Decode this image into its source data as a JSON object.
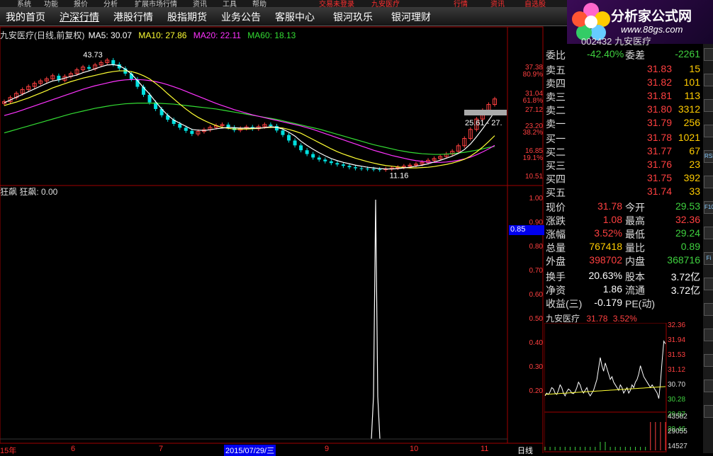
{
  "topbar": {
    "items": [
      "系统",
      "功能",
      "报价",
      "分析",
      "扩展市场行情",
      "资讯",
      "工具",
      "帮助",
      "交易未登录 ",
      "九安医疗",
      "行情",
      "资讯",
      "自选股"
    ]
  },
  "nav": {
    "items": [
      "我的首页",
      "沪深行情",
      "港股行情",
      "股指期货",
      "业务公告",
      "客服中心",
      "银河玖乐",
      "银河理财"
    ]
  },
  "logo": {
    "title": "分析家公式网",
    "url": "www.88gs.com"
  },
  "chart": {
    "title": "九安医疗(日线,前复权)",
    "ma5": "MA5: 30.07",
    "ma10": "MA10: 27.86",
    "ma20": "MA20: 22.11",
    "ma60": "MA60: 18.13",
    "high_label": "43.73",
    "low_label": "11.16",
    "range_label": "25.61 - 27.",
    "yaxis": [
      "37.38",
      "80.9%",
      "31.04",
      "61.8%",
      "27.12",
      "23.20",
      "38.2%",
      "16.85",
      "19.1%",
      "10.51"
    ],
    "indicator_title": "狂飙 狂飙: 0.00",
    "indicator_axis": [
      "1.00",
      "0.90",
      "0.80",
      "0.70",
      "0.60",
      "0.50",
      "0.40",
      "0.30",
      "0.20"
    ],
    "indicator_marker": "0.85",
    "xaxis": [
      "15年",
      "6",
      "7",
      "2015/07/29/三",
      "9",
      "10",
      "11",
      "日线"
    ],
    "series": {
      "closes": [
        31.0,
        32.2,
        33.4,
        34.5,
        35.4,
        36.3,
        37.0,
        37.6,
        38.5,
        37.2,
        38.3,
        39.1,
        40.2,
        41.0,
        40.5,
        41.6,
        42.3,
        43.0,
        41.8,
        40.6,
        39.1,
        37.5,
        35.3,
        33.0,
        30.8,
        28.9,
        27.1,
        25.8,
        24.6,
        23.5,
        22.6,
        21.7,
        22.4,
        22.9,
        23.6,
        24.1,
        24.4,
        23.6,
        22.8,
        23.3,
        23.7,
        23.2,
        23.8,
        24.4,
        24.0,
        22.7,
        21.4,
        19.8,
        18.4,
        17.0,
        15.9,
        14.9,
        14.3,
        13.8,
        13.3,
        12.9,
        12.5,
        12.1,
        11.8,
        11.7,
        11.6,
        11.5,
        11.4,
        11.6,
        11.9,
        12.1,
        12.4,
        12.7,
        13.0,
        13.5,
        14.1,
        14.6,
        15.2,
        15.9,
        16.7,
        18.3,
        20.4,
        23.0,
        26.0,
        28.5,
        30.2,
        31.8
      ],
      "ma5": [
        30.7,
        31.5,
        32.3,
        33.1,
        33.9,
        34.7,
        35.5,
        36.3,
        37.0,
        37.3,
        37.8,
        38.3,
        38.7,
        39.4,
        39.9,
        40.5,
        41.1,
        41.6,
        41.7,
        41.4,
        40.4,
        39.0,
        37.1,
        35.1,
        33.2,
        31.0,
        28.9,
        27.1,
        25.7,
        24.8,
        23.9,
        23.0,
        22.8,
        22.7,
        22.9,
        23.2,
        23.4,
        23.6,
        23.5,
        23.4,
        23.4,
        23.4,
        23.4,
        23.5,
        23.8,
        23.6,
        23.1,
        22.2,
        21.1,
        19.6,
        18.4,
        17.3,
        16.3,
        15.4,
        14.6,
        14.0,
        13.5,
        13.1,
        12.7,
        12.4,
        12.1,
        11.9,
        11.7,
        11.6,
        11.6,
        11.7,
        11.9,
        12.1,
        12.4,
        12.7,
        13.1,
        13.6,
        14.1,
        14.7,
        15.3,
        16.1,
        17.2,
        18.8,
        20.9,
        23.2,
        25.6,
        28.1
      ],
      "ma10": [
        29.9,
        30.4,
        30.9,
        31.5,
        32.1,
        32.8,
        33.5,
        34.2,
        35.0,
        35.6,
        36.2,
        36.8,
        37.3,
        37.8,
        38.2,
        38.6,
        39.0,
        39.4,
        39.7,
        39.9,
        39.9,
        39.7,
        39.2,
        38.5,
        37.6,
        36.3,
        34.9,
        33.3,
        31.8,
        30.3,
        28.9,
        27.6,
        26.5,
        25.6,
        24.8,
        24.1,
        23.6,
        23.3,
        23.1,
        23.1,
        23.1,
        23.2,
        23.3,
        23.5,
        23.6,
        23.6,
        23.4,
        23.0,
        22.5,
        21.9,
        21.0,
        20.1,
        19.2,
        18.3,
        17.4,
        16.6,
        15.9,
        15.3,
        14.7,
        14.2,
        13.7,
        13.3,
        12.9,
        12.6,
        12.4,
        12.2,
        12.0,
        11.9,
        11.9,
        12.0,
        12.1,
        12.3,
        12.6,
        12.9,
        13.3,
        13.8,
        14.4,
        15.3,
        16.5,
        17.9,
        19.5,
        21.2
      ],
      "ma20": [
        27.0,
        27.5,
        28.0,
        28.6,
        29.2,
        29.8,
        30.4,
        31.0,
        31.6,
        32.2,
        32.8,
        33.4,
        34.0,
        34.6,
        35.1,
        35.6,
        36.0,
        36.4,
        36.8,
        37.1,
        37.3,
        37.4,
        37.4,
        37.3,
        37.1,
        36.8,
        36.4,
        35.9,
        35.3,
        34.7,
        34.0,
        33.3,
        32.6,
        31.9,
        31.2,
        30.5,
        29.9,
        29.3,
        28.7,
        28.2,
        27.7,
        27.2,
        26.8,
        26.4,
        26.0,
        25.6,
        25.2,
        24.8,
        24.4,
        24.0,
        23.5,
        23.0,
        22.4,
        21.8,
        21.2,
        20.6,
        20.0,
        19.4,
        18.8,
        18.2,
        17.6,
        17.0,
        16.5,
        16.0,
        15.5,
        15.1,
        14.7,
        14.3,
        14.0,
        13.8,
        13.6,
        13.5,
        13.5,
        13.6,
        13.8,
        14.1,
        14.5,
        15.0,
        15.7,
        16.5,
        17.4,
        18.4
      ],
      "ma60": [
        22.0,
        22.5,
        23.0,
        23.5,
        24.0,
        24.5,
        25.0,
        25.5,
        26.0,
        26.5,
        27.0,
        27.5,
        27.9,
        28.3,
        28.7,
        29.1,
        29.4,
        29.7,
        30.0,
        30.2,
        30.4,
        30.5,
        30.6,
        30.6,
        30.6,
        30.6,
        30.5,
        30.4,
        30.3,
        30.1,
        29.9,
        29.7,
        29.5,
        29.3,
        29.1,
        28.9,
        28.6,
        28.3,
        28.0,
        27.7,
        27.4,
        27.1,
        26.8,
        26.5,
        26.2,
        25.9,
        25.5,
        25.1,
        24.7,
        24.3,
        23.9,
        23.5,
        23.1,
        22.6,
        22.1,
        21.6,
        21.1,
        20.6,
        20.1,
        19.6,
        19.1,
        18.6,
        18.2,
        17.8,
        17.4,
        17.0,
        16.7,
        16.4,
        16.2,
        16.0,
        15.9,
        15.8,
        15.8,
        15.9,
        16.0,
        16.2,
        16.4,
        16.7,
        17.0,
        17.4,
        17.8,
        18.1
      ]
    },
    "spike_index": 64
  },
  "quote": {
    "code": "002432 九安医疗",
    "weibi_label": "委比",
    "weibi": "-42.40%",
    "weicha_label": "委差",
    "weicha": "-2261",
    "sell": [
      {
        "label": "卖五",
        "price": "31.83",
        "vol": "15"
      },
      {
        "label": "卖四",
        "price": "31.82",
        "vol": "101"
      },
      {
        "label": "卖三",
        "price": "31.81",
        "vol": "113"
      },
      {
        "label": "卖二",
        "price": "31.80",
        "vol": "3312"
      },
      {
        "label": "卖一",
        "price": "31.79",
        "vol": "256"
      }
    ],
    "buy": [
      {
        "label": "买一",
        "price": "31.78",
        "vol": "1021"
      },
      {
        "label": "买二",
        "price": "31.77",
        "vol": "67"
      },
      {
        "label": "买三",
        "price": "31.76",
        "vol": "23"
      },
      {
        "label": "买四",
        "price": "31.75",
        "vol": "392"
      },
      {
        "label": "买五",
        "price": "31.74",
        "vol": "33"
      }
    ],
    "stats": [
      {
        "l1": "现价",
        "v1": "31.78",
        "c1": "red",
        "l2": "今开",
        "v2": "29.53",
        "c2": "green"
      },
      {
        "l1": "涨跌",
        "v1": "1.08",
        "c1": "red",
        "l2": "最高",
        "v2": "32.36",
        "c2": "red"
      },
      {
        "l1": "涨幅",
        "v1": "3.52%",
        "c1": "red",
        "l2": "最低",
        "v2": "29.24",
        "c2": "green"
      },
      {
        "l1": "总量",
        "v1": "767418",
        "c1": "yellow",
        "l2": "量比",
        "v2": "0.89",
        "c2": "green"
      },
      {
        "l1": "外盘",
        "v1": "398702",
        "c1": "red",
        "l2": "内盘",
        "v2": "368716",
        "c2": "green"
      },
      {
        "l1": "换手",
        "v1": "20.63%",
        "c1": "white",
        "l2": "股本",
        "v2": "3.72亿",
        "c2": "white"
      },
      {
        "l1": "净资",
        "v1": "1.86",
        "c1": "white",
        "l2": "流通",
        "v2": "3.72亿",
        "c2": "white"
      },
      {
        "l1": "收益(三)",
        "v1": "-0.179",
        "c1": "white",
        "l2": "PE(动)",
        "v2": "",
        "c2": "white"
      }
    ]
  },
  "mini": {
    "title": "九安医疗",
    "price": "31.78",
    "pct": "3.52%",
    "yaxis": [
      "32.36",
      "31.94",
      "31.53",
      "31.12",
      "30.70",
      "30.28",
      "29.87",
      "29.46"
    ],
    "vol_labels": [
      "43582",
      "29055",
      "14527"
    ]
  },
  "rightcol": {
    "items": [
      "",
      "",
      "",
      "",
      "RSI",
      "",
      "F10",
      "",
      "Fi",
      "",
      "",
      "",
      "",
      "",
      ""
    ]
  },
  "colors": {
    "up": "#ff4040",
    "down": "#00e0e0",
    "ma5": "#ffffff",
    "ma10": "#ffff33",
    "ma20": "#ff33ff",
    "ma60": "#33dd33",
    "frame": "#a00000"
  }
}
